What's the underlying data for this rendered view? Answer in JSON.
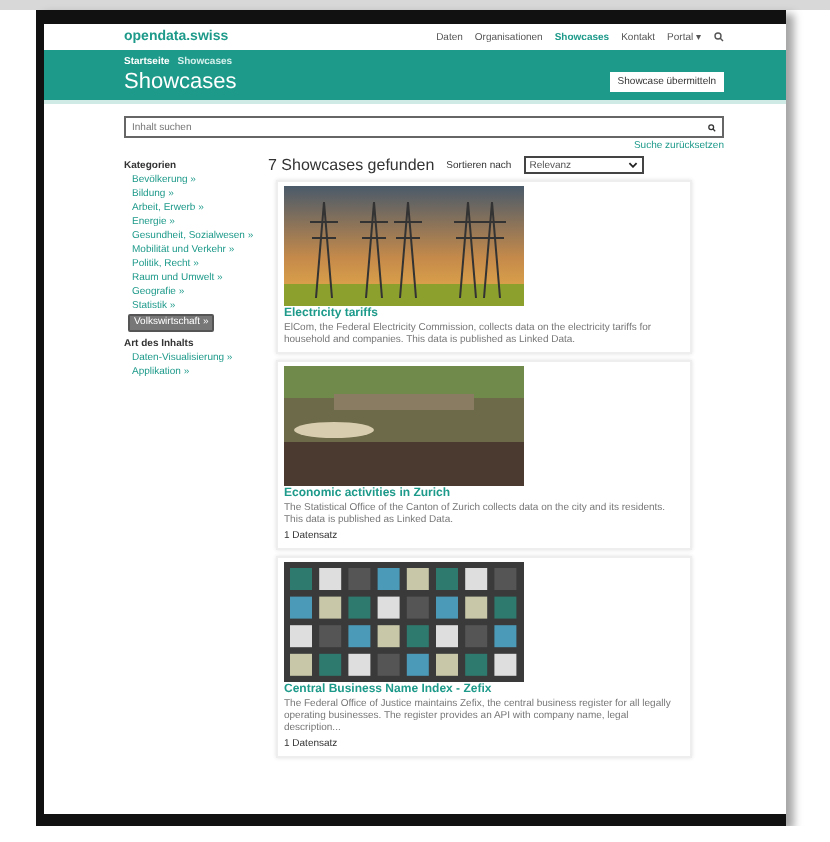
{
  "header": {
    "logo": "opendata.swiss",
    "nav": [
      {
        "label": "Daten",
        "selected": false
      },
      {
        "label": "Organisationen",
        "selected": false
      },
      {
        "label": "Showcases",
        "selected": true
      },
      {
        "label": "Kontakt",
        "selected": false
      },
      {
        "label": "Portal ▾",
        "selected": false
      }
    ]
  },
  "hero": {
    "breadcrumb": [
      "Startseite",
      "Showcases"
    ],
    "title": "Showcases",
    "button": "Showcase übermitteln"
  },
  "search": {
    "placeholder": "Inhalt suchen",
    "reset": "Suche zurücksetzen"
  },
  "sidebar": {
    "groups": [
      {
        "title": "Kategorien",
        "items": [
          {
            "label": "Bevölkerung »",
            "selected": false
          },
          {
            "label": "Bildung »",
            "selected": false
          },
          {
            "label": "Arbeit, Erwerb »",
            "selected": false
          },
          {
            "label": "Energie »",
            "selected": false
          },
          {
            "label": "Gesundheit, Sozialwesen »",
            "selected": false
          },
          {
            "label": "Mobilität und Verkehr »",
            "selected": false
          },
          {
            "label": "Politik, Recht »",
            "selected": false
          },
          {
            "label": "Raum und Umwelt »",
            "selected": false
          },
          {
            "label": "Geografie »",
            "selected": false
          },
          {
            "label": "Statistik »",
            "selected": false
          },
          {
            "label": "Volkswirtschaft »",
            "selected": true
          }
        ]
      },
      {
        "title": "Art des Inhalts",
        "items": [
          {
            "label": "Daten-Visualisierung »",
            "selected": false
          },
          {
            "label": "Applikation »",
            "selected": false
          }
        ]
      }
    ]
  },
  "results": {
    "count": "7 Showcases gefunden",
    "sort_label": "Sortieren nach",
    "sort_value": "Relevanz"
  },
  "cards": [
    {
      "kind": "towers",
      "title": "Electricity tariffs",
      "description": "ElCom, the Federal Electricity Commission, collects data on the electricity tariffs for household and companies. This data is published as Linked Data."
    },
    {
      "kind": "street",
      "title": "Economic activities in Zurich",
      "description": "The Statistical Office of the Canton of Zurich collects data on the city and its residents. This data is published as Linked Data.",
      "datasets": "1 Datensatz"
    },
    {
      "kind": "boxes",
      "title": "Central Business Name Index - Zefix",
      "description": "The Federal Office of Justice maintains Zefix, the central business register for all legally operating businesses. The register provides an API with company name, legal description...",
      "datasets": "1 Datensatz"
    }
  ]
}
